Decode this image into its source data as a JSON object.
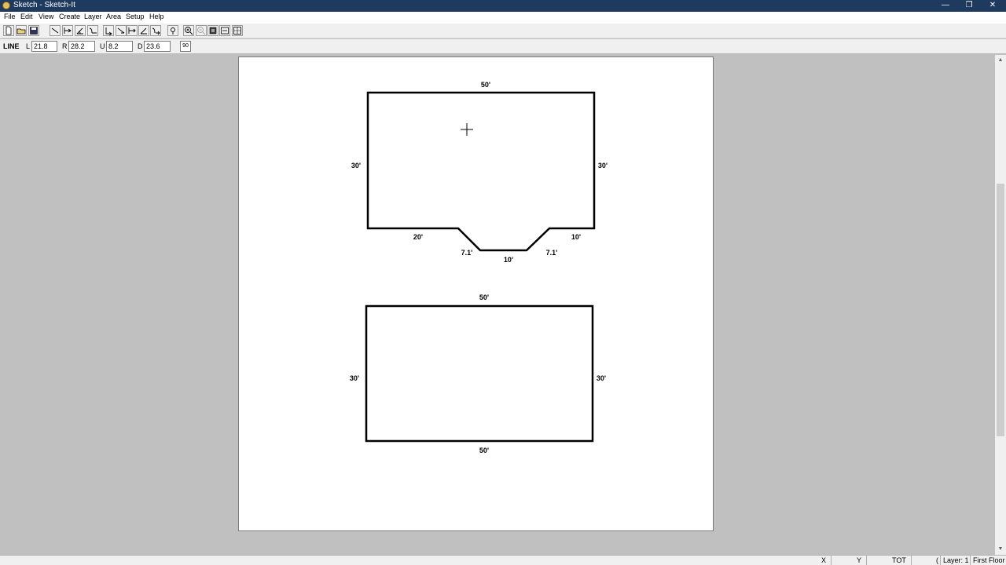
{
  "window": {
    "title": "Sketch - Sketch-It",
    "minimize": "—",
    "restore": "❐",
    "close": "✕"
  },
  "menu": [
    "File",
    "Edit",
    "View",
    "Create",
    "Layer",
    "Area",
    "Setup",
    "Help"
  ],
  "toolbar": {
    "icons": [
      "new-file-icon",
      "open-file-icon",
      "save-icon",
      "line-tool-icon",
      "arc-tool-icon",
      "angle-tool-icon",
      "curve-tool-icon",
      "door-tool-icon",
      "window-tool-icon",
      "wall-tool-icon",
      "corner-tool-icon",
      "stair-tool-icon",
      "pin-icon",
      "zoom-in-icon",
      "zoom-out-icon",
      "fill-icon",
      "dimension-icon",
      "grid-icon"
    ]
  },
  "props": {
    "mode": "LINE",
    "L_label": "L",
    "L_value": "21.8",
    "R_label": "R",
    "R_value": "28.2",
    "U_label": "U",
    "U_value": "8.2",
    "D_label": "D",
    "D_value": "23.6",
    "angle_button": "90"
  },
  "sketch": {
    "shape1": {
      "top": "50'",
      "left": "30'",
      "right": "30'",
      "bottom_left": "20'",
      "bottom_right": "10'",
      "bay_left": "7.1'",
      "bay_bottom": "10'",
      "bay_right": "7.1'"
    },
    "shape2": {
      "top": "50'",
      "left": "30'",
      "right": "30'",
      "bottom": "50'"
    }
  },
  "status": {
    "x_label": "X",
    "y_label": "Y",
    "tot_label": "TOT",
    "extra": "(",
    "layer": "Layer: 1",
    "floor": "First Floor"
  }
}
